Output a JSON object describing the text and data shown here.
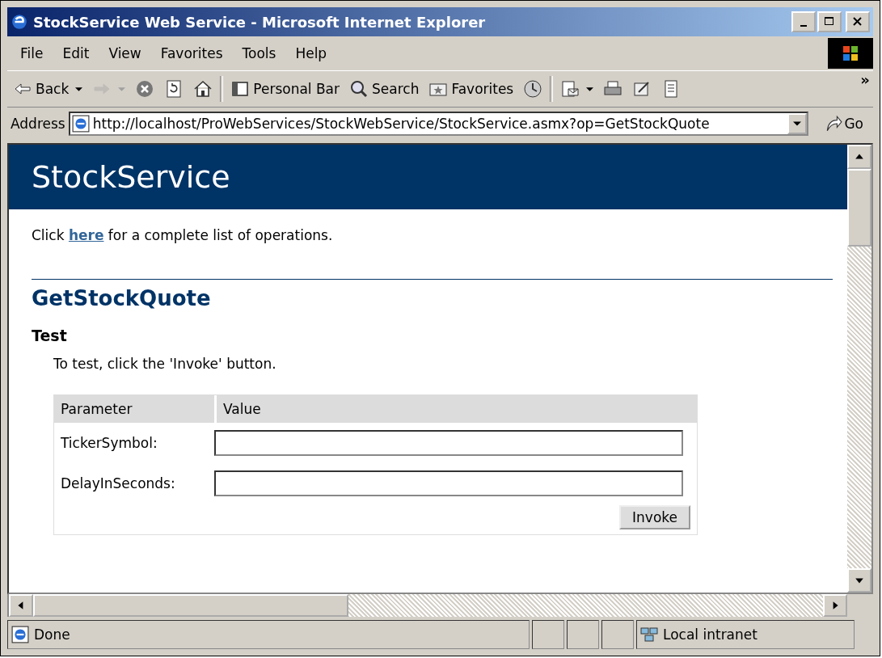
{
  "window": {
    "title": "StockService Web Service - Microsoft Internet Explorer"
  },
  "menu": [
    "File",
    "Edit",
    "View",
    "Favorites",
    "Tools",
    "Help"
  ],
  "toolbar": [
    {
      "kind": "back",
      "label": "Back",
      "dropdown": true,
      "disabled": false
    },
    {
      "kind": "forward",
      "dropdown": true,
      "disabled": true
    },
    {
      "kind": "stop",
      "dropdown": false,
      "disabled": false
    },
    {
      "kind": "refresh",
      "dropdown": false,
      "disabled": false
    },
    {
      "kind": "home",
      "dropdown": false,
      "disabled": false
    },
    {
      "kind": "separator"
    },
    {
      "kind": "personal",
      "label": "Personal Bar",
      "dropdown": false,
      "disabled": false
    },
    {
      "kind": "search",
      "label": "Search",
      "dropdown": false,
      "disabled": false
    },
    {
      "kind": "favorites",
      "label": "Favorites",
      "dropdown": false,
      "disabled": false
    },
    {
      "kind": "history",
      "dropdown": false,
      "disabled": false
    },
    {
      "kind": "separator"
    },
    {
      "kind": "mail",
      "dropdown": true,
      "disabled": false
    },
    {
      "kind": "print",
      "dropdown": false,
      "disabled": false
    },
    {
      "kind": "edit",
      "dropdown": false,
      "disabled": false
    },
    {
      "kind": "discuss",
      "dropdown": false,
      "disabled": false
    }
  ],
  "toolbar_overflow": "»",
  "address": {
    "label": "Address",
    "url": "http://localhost/ProWebServices/StockWebService/StockService.asmx?op=GetStockQuote",
    "go": "Go"
  },
  "page": {
    "heading": "StockService",
    "intro_before": "Click ",
    "intro_link": "here",
    "intro_after": " for a complete list of operations.",
    "operation": "GetStockQuote",
    "test_heading": "Test",
    "instruction": "To test, click the 'Invoke' button.",
    "table": {
      "columns": [
        "Parameter",
        "Value"
      ],
      "rows": [
        {
          "label": "TickerSymbol:"
        },
        {
          "label": "DelayInSeconds:"
        }
      ],
      "button": "Invoke"
    }
  },
  "status_bar": {
    "text": "Done",
    "zone": "Local intranet"
  }
}
